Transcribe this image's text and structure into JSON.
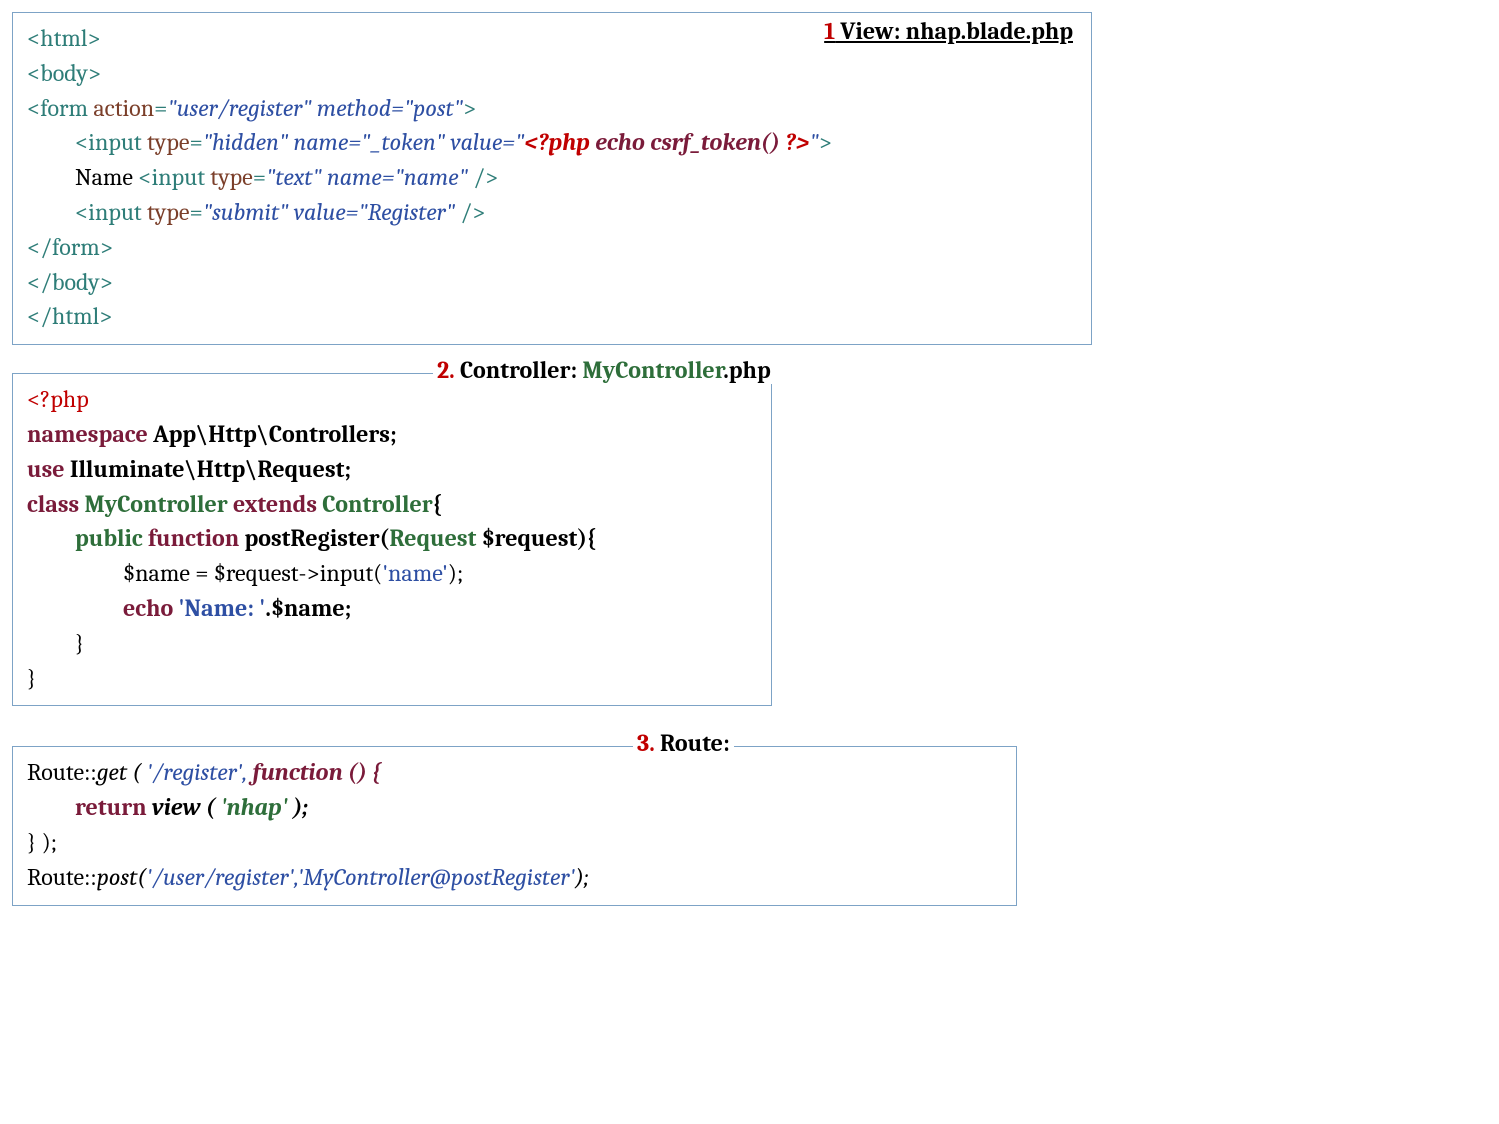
{
  "panel1": {
    "heading_num": "1",
    "heading_text": " View: nhap.blade.php",
    "l1": "<html>",
    "l2": "<body>",
    "l3a": "<form ",
    "l3b": "action",
    "l3c": "=",
    "l3d": "\"user/register\" method=\"post\"",
    "l3e": ">",
    "l4a": "<input ",
    "l4b": "type",
    "l4c": "=",
    "l4d": "\"hidden\" name=\"_token\" value=\"",
    "l4e": "<?php ",
    "l4f": "echo csrf_token() ",
    "l4g": "?>",
    "l4h": "\"",
    "l4i": ">",
    "l5a": "Name ",
    "l5b": "<input ",
    "l5c": "type",
    "l5d": "=",
    "l5e": "\"text\" name=\"name\" ",
    "l5f": "/>",
    "l6a": "<input ",
    "l6b": "type",
    "l6c": "=",
    "l6d": "\"submit\" value=\"Register\" ",
    "l6e": "/>",
    "l7": "</form>",
    "l8": "</body>",
    "l9": "</html>"
  },
  "panel2": {
    "heading_num": "2.",
    "heading_label": " Controller: ",
    "heading_class": "MyController",
    "heading_ext": ".php",
    "l1": "<?php",
    "l2a": "namespace ",
    "l2b": "App\\Http\\Controllers;",
    "l3a": "use ",
    "l3b": "Illuminate\\Http\\Request;",
    "l4a": "class ",
    "l4b": "MyController ",
    "l4c": "extends ",
    "l4d": "Controller",
    "l4e": "{",
    "l5a": "public ",
    "l5b": "function ",
    "l5c": "postRegister(",
    "l5d": "Request ",
    "l5e": "$request){",
    "l6a": "$name = $request->input(",
    "l6b": "'name'",
    "l6c": ");",
    "l7a": "echo ",
    "l7b": "'Name: '",
    "l7c": ".$name;",
    "l8": "}",
    "l9": "}"
  },
  "panel3": {
    "heading_num": "3.",
    "heading_label": " Route:",
    "l1a": "Route::",
    "l1b": "get ( ",
    "l1c": "'/register', ",
    "l1d": "function () {",
    "l2a": "return ",
    "l2b": "view ( ",
    "l2c": "'nhap' ",
    "l2d": ");",
    "l3": "} );",
    "l4a": "Route::",
    "l4b": "post(",
    "l4c": "'/user/register','MyController@postRegister'",
    "l4d": ");"
  }
}
